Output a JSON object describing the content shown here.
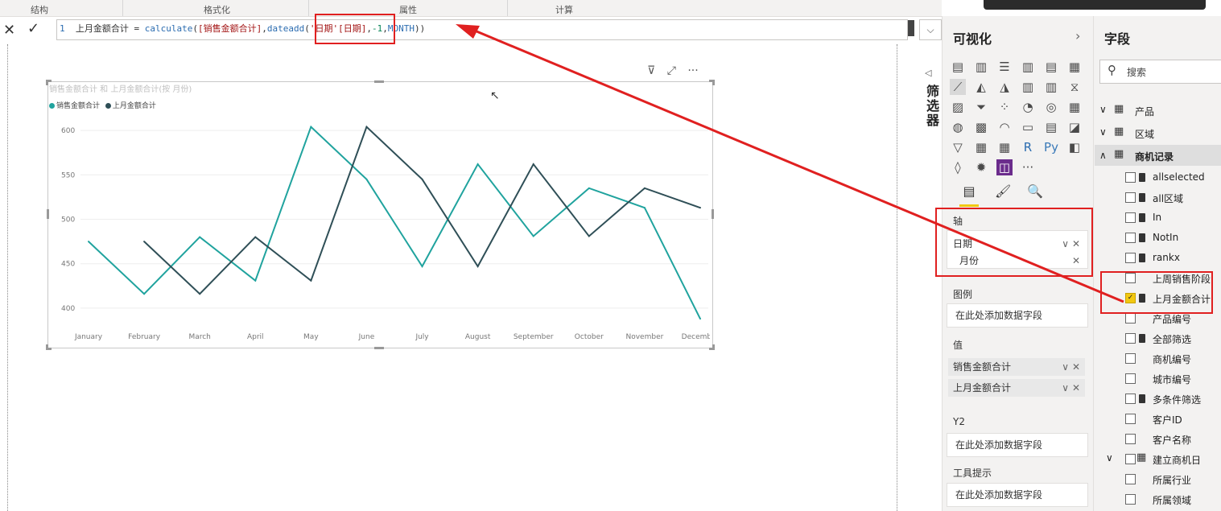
{
  "ribbon": {
    "labels": [
      "结构",
      "格式化",
      "属性",
      "计算"
    ]
  },
  "formula_bar": {
    "line_number": "1",
    "measure_name": "上月金额合计",
    "op": " = ",
    "fn1": "calculate",
    "paren_open": "(",
    "arg1": "[销售金额合计]",
    "comma1": ",",
    "fn2": "dateadd",
    "paren_open2": "(",
    "arg2": "'日期'[日期]",
    "comma2": ",",
    "arg3": "-1",
    "comma3": ",",
    "arg4": "MONTH",
    "paren_close": "))",
    "cancel_icon": "x-icon",
    "commit_icon": "check-icon"
  },
  "visual": {
    "title": "销售金额合计 和 上月金额合计(按 月份)",
    "legend": [
      {
        "label": "销售金额合计",
        "color": "#20a39e"
      },
      {
        "label": "上月金额合计",
        "color": "#2f4f57"
      }
    ]
  },
  "chart_data": {
    "type": "line",
    "title": "销售金额合计 和 上月金额合计(按 月份)",
    "xlabel": "",
    "ylabel": "",
    "categories": [
      "January",
      "February",
      "March",
      "April",
      "May",
      "June",
      "July",
      "August",
      "September",
      "October",
      "November",
      "December"
    ],
    "yticks": [
      400,
      450,
      500,
      550,
      600
    ],
    "ylim": [
      380,
      620
    ],
    "grid": true,
    "legend_position": "top-left",
    "series": [
      {
        "name": "销售金额合计",
        "color": "#20a39e",
        "values": [
          475,
          416,
          480,
          431,
          604,
          545,
          447,
          562,
          481,
          535,
          513,
          388
        ]
      },
      {
        "name": "上月金额合计",
        "color": "#2f4f57",
        "values": [
          null,
          475,
          416,
          480,
          431,
          604,
          545,
          447,
          562,
          481,
          535,
          513
        ]
      }
    ]
  },
  "filter_strip": {
    "label": "筛选器"
  },
  "viz_pane": {
    "title": "可视化",
    "axis_label": "轴",
    "axis_fields": [
      "日期",
      "月份"
    ],
    "legend_label": "图例",
    "legend_placeholder": "在此处添加数据字段",
    "values_label": "值",
    "values_fields": [
      "销售金额合计",
      "上月金额合计"
    ],
    "y2_label": "Y2",
    "y2_placeholder": "在此处添加数据字段",
    "tooltip_label": "工具提示",
    "tooltip_placeholder": "在此处添加数据字段",
    "more_label": "···",
    "r_label": "R",
    "py_label": "Py"
  },
  "fields_pane": {
    "title": "字段",
    "search_placeholder": "搜索",
    "tables": [
      {
        "name": "产品",
        "expanded": false
      },
      {
        "name": "区域",
        "expanded": false
      },
      {
        "name": "商机记录",
        "expanded": true
      }
    ],
    "fields": [
      {
        "name": "allselected",
        "calc": true,
        "checked": false
      },
      {
        "name": "all区域",
        "calc": true,
        "checked": false
      },
      {
        "name": "In",
        "calc": true,
        "checked": false
      },
      {
        "name": "NotIn",
        "calc": true,
        "checked": false
      },
      {
        "name": "rankx",
        "calc": true,
        "checked": false
      },
      {
        "name": "上周销售阶段",
        "calc": false,
        "checked": false
      },
      {
        "name": "上月金额合计",
        "calc": true,
        "checked": true
      },
      {
        "name": "产品编号",
        "calc": false,
        "checked": false
      },
      {
        "name": "全部筛选",
        "calc": true,
        "checked": false
      },
      {
        "name": "商机编号",
        "calc": false,
        "checked": false
      },
      {
        "name": "城市编号",
        "calc": false,
        "checked": false
      },
      {
        "name": "多条件筛选",
        "calc": true,
        "checked": false
      },
      {
        "name": "客户ID",
        "calc": false,
        "checked": false
      },
      {
        "name": "客户名称",
        "calc": false,
        "checked": false
      },
      {
        "name": "建立商机日",
        "calc": false,
        "checked": false,
        "date": true
      },
      {
        "name": "所属行业",
        "calc": false,
        "checked": false
      },
      {
        "name": "所属领域",
        "calc": false,
        "checked": false
      }
    ]
  },
  "colors": {
    "accent_red": "#e02020",
    "check_yellow": "#f2c811",
    "series1": "#20a39e",
    "series2": "#2f4f57"
  }
}
